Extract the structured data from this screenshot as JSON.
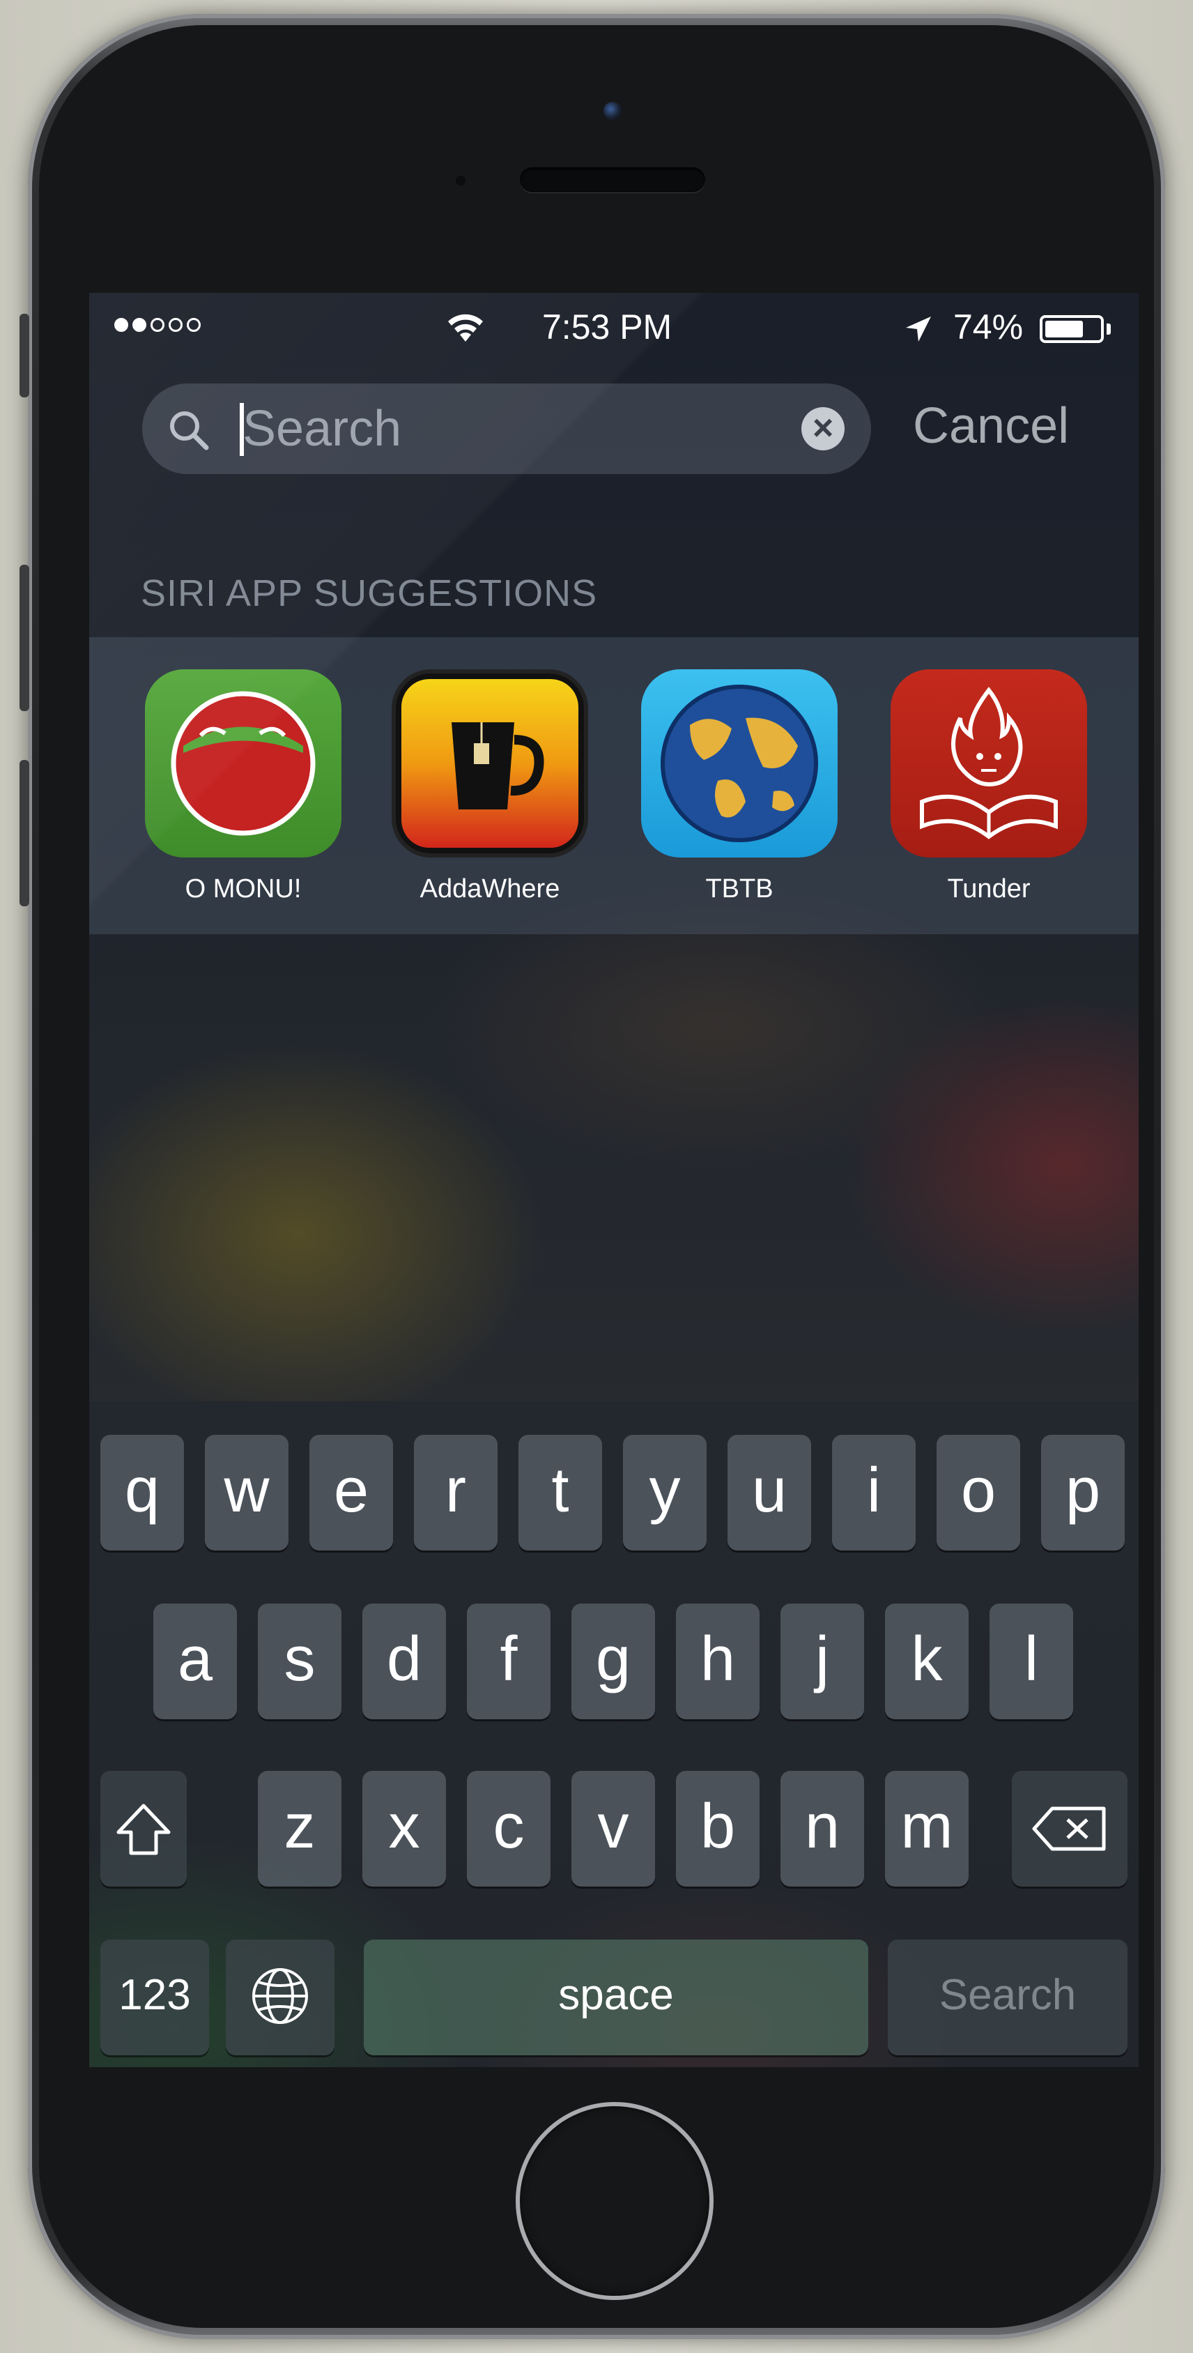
{
  "status_bar": {
    "time": "7:53 PM",
    "battery_percent": "74%",
    "signal_bars_filled": 2,
    "signal_bars_total": 5,
    "battery_level": 0.74
  },
  "search": {
    "placeholder": "Search",
    "cancel_label": "Cancel"
  },
  "suggestions": {
    "title": "SIRI APP SUGGESTIONS",
    "apps": [
      {
        "label": "O MONU!",
        "icon": "green-laughing-face-icon"
      },
      {
        "label": "AddaWhere",
        "icon": "tea-cup-icon"
      },
      {
        "label": "TBTB",
        "icon": "globe-icon"
      },
      {
        "label": "Tunder",
        "icon": "flame-book-reader-icon"
      }
    ]
  },
  "keyboard": {
    "row1": [
      "q",
      "w",
      "e",
      "r",
      "t",
      "y",
      "u",
      "i",
      "o",
      "p"
    ],
    "row2": [
      "a",
      "s",
      "d",
      "f",
      "g",
      "h",
      "j",
      "k",
      "l"
    ],
    "row3": [
      "z",
      "x",
      "c",
      "v",
      "b",
      "n",
      "m"
    ],
    "numbers_label": "123",
    "space_label": "space",
    "return_label": "Search",
    "shift_icon": "shift-icon",
    "delete_icon": "backspace-icon",
    "globe_icon": "globe-keyboard-icon"
  },
  "colors": {
    "accent_text": "#ffffff",
    "muted_text": "#7f8792"
  }
}
